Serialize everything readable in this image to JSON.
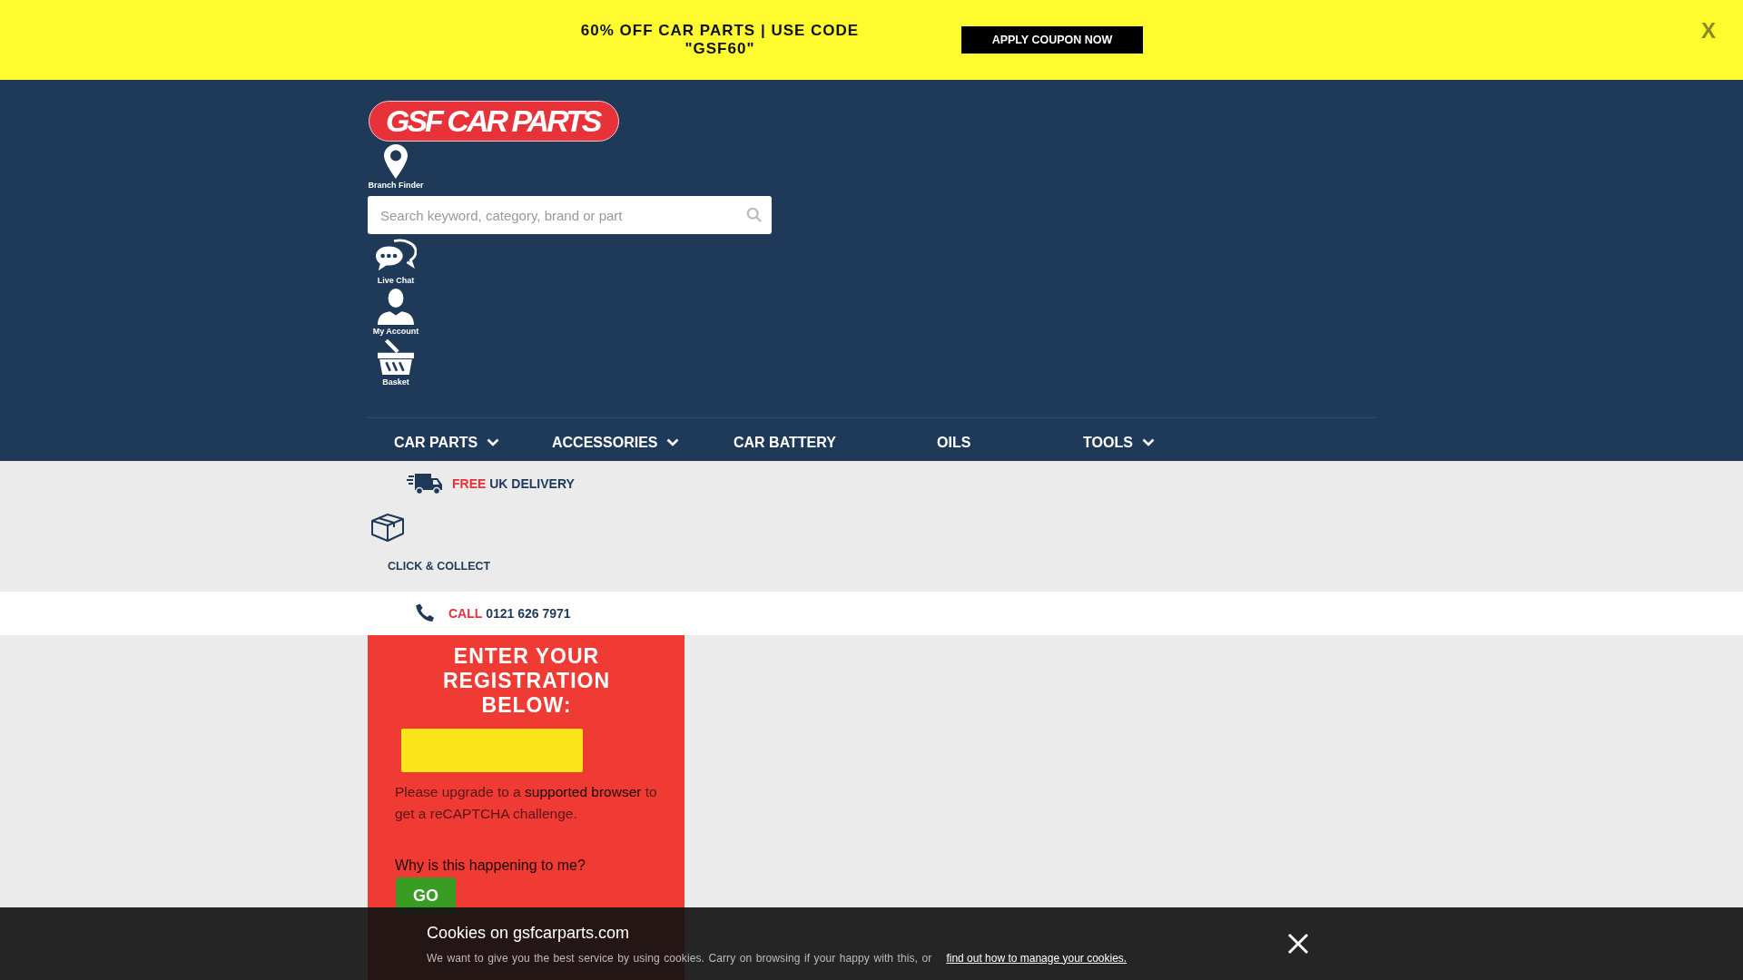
{
  "promo_banner": {
    "message": "60% OFF CAR PARTS | USE CODE \"GSF60\"",
    "button": "APPLY COUPON NOW",
    "close": "X"
  },
  "header": {
    "logo": "GSF CAR PARTS",
    "branch_finder": "Branch Finder",
    "search": {
      "placeholder": "Search keyword, category, brand or part"
    },
    "quick_links": [
      {
        "kind": "chat",
        "label": "Live Chat"
      },
      {
        "kind": "account",
        "label": "My Account"
      },
      {
        "kind": "basket",
        "label": "Basket"
      }
    ]
  },
  "nav": [
    {
      "label": "CAR PARTS",
      "has_dropdown": true
    },
    {
      "label": "ACCESSORIES",
      "has_dropdown": true
    },
    {
      "label": "CAR BATTERY",
      "has_dropdown": false
    },
    {
      "label": "OILS",
      "has_dropdown": false
    },
    {
      "label": "TOOLS",
      "has_dropdown": true
    }
  ],
  "delivery": {
    "highlight": "FREE",
    "text": "UK DELIVERY"
  },
  "click_collect": "CLICK & COLLECT",
  "call": {
    "highlight": "CALL",
    "number": "0121 626 7971"
  },
  "registration": {
    "heading": "ENTER YOUR REGISTRATION BELOW:",
    "captcha_before": "Please upgrade to a",
    "captcha_link": "supported browser",
    "captcha_after": "to get a reCAPTCHA challenge.",
    "why": "Why is this happening to me?",
    "go_button": "GO"
  },
  "cookie_bar": {
    "title": "Cookies on gsfcarparts.com",
    "message": "We want to give you the best service by using cookies. Carry on browsing if your happy with this, or",
    "link": "find out how to manage your cookies."
  }
}
